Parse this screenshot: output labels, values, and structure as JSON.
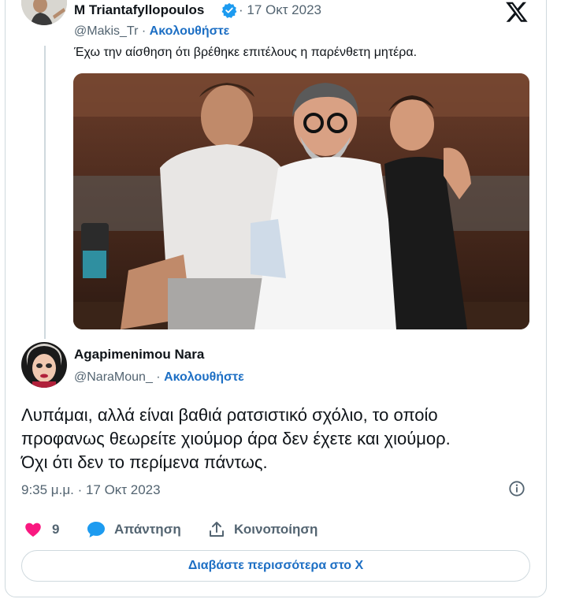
{
  "quoted_tweet": {
    "author_name": "M Triantafyllopoulos",
    "verified": true,
    "date": "· 17 Οκτ 2023",
    "handle": "@Makis_Tr ·",
    "follow_label": "Ακολουθήστε",
    "text": "Έχω την αίσθηση ότι βρέθηκε επιτέλους η παρένθετη μητέρα."
  },
  "reply_tweet": {
    "author_name": "Agapimenimou Nara",
    "handle": "@NaraMoun_ ·",
    "follow_label": "Ακολουθήστε",
    "text": "Λυπάμαι, αλλά είναι βαθιά ρατσιστικό σχόλιο, το οποίο\nπροφανως θεωρείτε χιούμορ άρα δεν έχετε και χιούμορ.\nΌχι ότι δεν το περίμενα πάντως.",
    "timestamp": "9:35 μ.μ. · 17 Οκτ 2023"
  },
  "actions": {
    "like_count": "9",
    "reply_label": "Απάντηση",
    "share_label": "Κοινοποίηση"
  },
  "read_more_label": "Διαβάστε περισσότερα στο X",
  "colors": {
    "link": "#1d6fc4",
    "like": "#f91880",
    "reply": "#1d9bf0",
    "verified": "#1d9bf0",
    "muted": "#536471"
  },
  "icons": [
    "x-logo-icon",
    "verified-badge-icon",
    "info-icon",
    "heart-icon",
    "reply-bubble-icon",
    "share-icon"
  ]
}
